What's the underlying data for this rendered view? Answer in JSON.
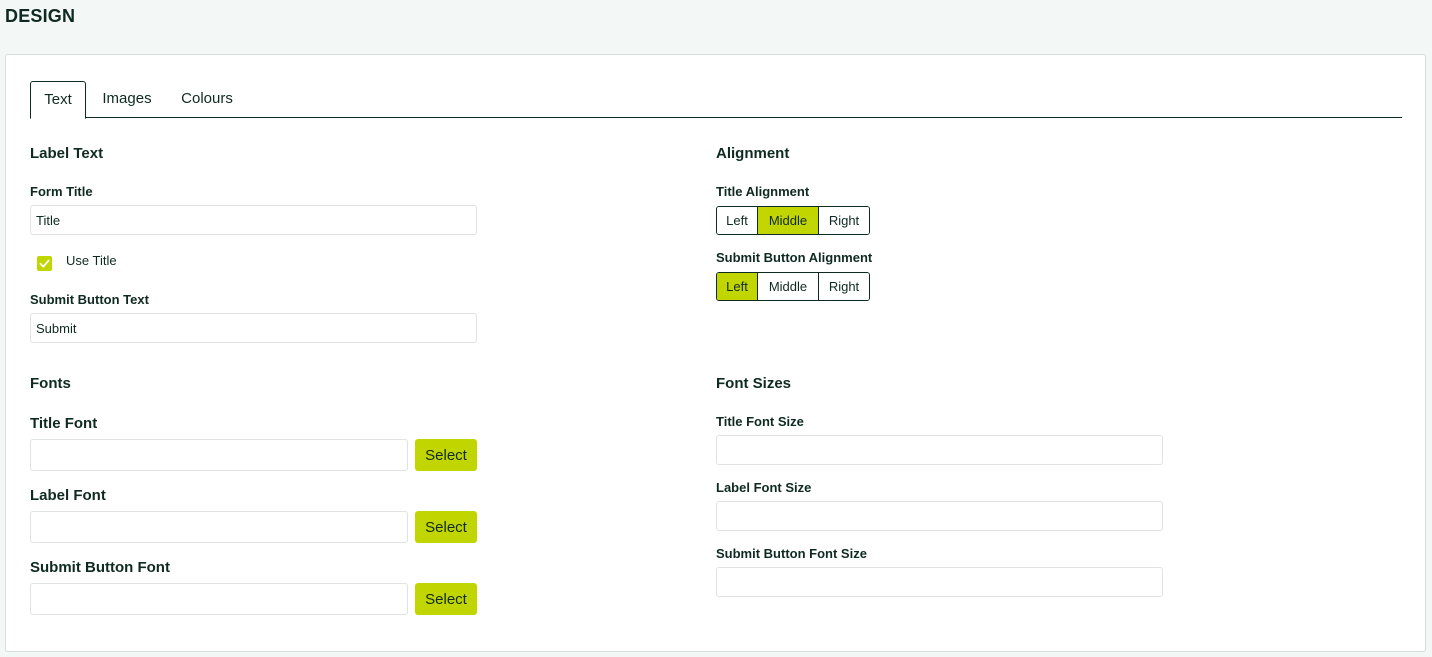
{
  "page": {
    "title": "DESIGN"
  },
  "tabs": [
    {
      "label": "Text"
    },
    {
      "label": "Images"
    },
    {
      "label": "Colours"
    }
  ],
  "label_text": {
    "heading": "Label Text",
    "form_title_label": "Form Title",
    "form_title_value": "Title",
    "use_title_label": "Use Title",
    "use_title_checked": true,
    "submit_text_label": "Submit Button Text",
    "submit_text_value": "Submit"
  },
  "alignment": {
    "heading": "Alignment",
    "title_alignment_label": "Title Alignment",
    "title_alignment_selected": "Middle",
    "submit_alignment_label": "Submit Button Alignment",
    "submit_alignment_selected": "Left",
    "options": [
      "Left",
      "Middle",
      "Right"
    ]
  },
  "fonts": {
    "heading": "Fonts",
    "title_font_label": "Title Font",
    "label_font_label": "Label Font",
    "submit_font_label": "Submit Button Font",
    "select_label": "Select"
  },
  "font_sizes": {
    "heading": "Font Sizes",
    "title_size_label": "Title Font Size",
    "label_size_label": "Label Font Size",
    "submit_size_label": "Submit Button Font Size"
  },
  "colors": {
    "accent": "#c1d600",
    "text": "#0f2a22",
    "background": "#f3f7f6"
  }
}
